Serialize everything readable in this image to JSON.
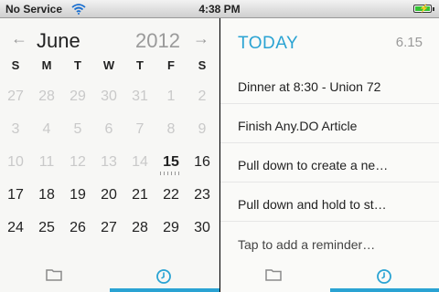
{
  "status_bar": {
    "carrier": "No Service",
    "time": "4:38 PM",
    "battery_level": 1.0
  },
  "calendar": {
    "month": "June",
    "year": "2012",
    "prev_icon": "left-arrow-icon",
    "next_icon": "right-arrow-icon",
    "weekdays": [
      "S",
      "M",
      "T",
      "W",
      "T",
      "F",
      "S"
    ],
    "weeks": [
      [
        {
          "d": "27",
          "dim": true
        },
        {
          "d": "28",
          "dim": true
        },
        {
          "d": "29",
          "dim": true
        },
        {
          "d": "30",
          "dim": true
        },
        {
          "d": "31",
          "dim": true
        },
        {
          "d": "1",
          "dim": true
        },
        {
          "d": "2",
          "dim": true
        }
      ],
      [
        {
          "d": "3",
          "dim": true
        },
        {
          "d": "4",
          "dim": true
        },
        {
          "d": "5",
          "dim": true
        },
        {
          "d": "6",
          "dim": true
        },
        {
          "d": "7",
          "dim": true
        },
        {
          "d": "8",
          "dim": true
        },
        {
          "d": "9",
          "dim": true
        }
      ],
      [
        {
          "d": "10",
          "dim": true
        },
        {
          "d": "11",
          "dim": true
        },
        {
          "d": "12",
          "dim": true
        },
        {
          "d": "13",
          "dim": true
        },
        {
          "d": "14",
          "dim": true
        },
        {
          "d": "15",
          "dim": false,
          "today": true
        },
        {
          "d": "16",
          "dim": false
        }
      ],
      [
        {
          "d": "17",
          "dim": false
        },
        {
          "d": "18",
          "dim": false
        },
        {
          "d": "19",
          "dim": false
        },
        {
          "d": "20",
          "dim": false
        },
        {
          "d": "21",
          "dim": false
        },
        {
          "d": "22",
          "dim": false
        },
        {
          "d": "23",
          "dim": false
        }
      ],
      [
        {
          "d": "24",
          "dim": false
        },
        {
          "d": "25",
          "dim": false
        },
        {
          "d": "26",
          "dim": false
        },
        {
          "d": "27",
          "dim": false
        },
        {
          "d": "28",
          "dim": false
        },
        {
          "d": "29",
          "dim": false
        },
        {
          "d": "30",
          "dim": false
        }
      ]
    ]
  },
  "left_tabs": {
    "folder_icon": "folder-icon",
    "clock_icon": "clock-icon",
    "active": "clock"
  },
  "today_list": {
    "title": "TODAY",
    "date": "6.15",
    "tasks": [
      "Dinner at 8:30 - Union 72",
      "Finish Any.DO Article",
      "Pull down to create a ne…",
      "Pull down and hold to st…",
      "Tap to add a reminder…"
    ]
  },
  "right_tabs": {
    "folder_icon": "folder-icon",
    "clock_icon": "clock-icon",
    "active": "clock"
  },
  "colors": {
    "accent": "#2aa3d3",
    "dim_text": "#c9c9c9",
    "text": "#222222"
  }
}
